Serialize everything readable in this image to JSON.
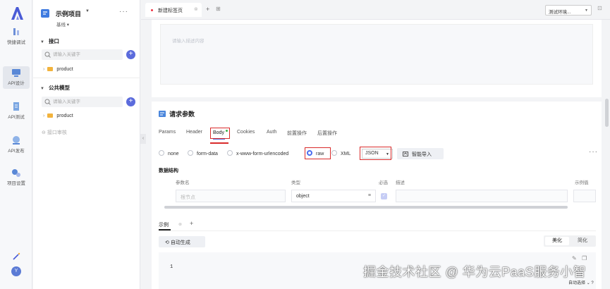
{
  "rail": {
    "items": [
      {
        "label": "快捷调试",
        "icon": "bug-debug-icon"
      },
      {
        "label": "API设计",
        "icon": "api-design-icon"
      },
      {
        "label": "API测试",
        "icon": "api-test-icon"
      },
      {
        "label": "API发布",
        "icon": "api-publish-icon"
      },
      {
        "label": "项目设置",
        "icon": "project-settings-icon"
      }
    ],
    "avatar_letter": "Y",
    "accent": "#5b6bdc"
  },
  "tree": {
    "project_name": "示例项目",
    "branch": "基线",
    "sections": [
      {
        "title": "接口",
        "search_placeholder": "请输入关键字",
        "node": "product"
      },
      {
        "title": "公共模型",
        "search_placeholder": "请输入关键字",
        "node": "product"
      }
    ],
    "recycle_label": "接口审核"
  },
  "tabbar": {
    "tab_label": "新建标签页",
    "env_label": "测试环境...",
    "env_caret": "▼"
  },
  "description": {
    "placeholder": "请输入描述内容"
  },
  "request": {
    "title": "请求参数",
    "tabs": [
      "Params",
      "Header",
      "Body",
      "Cookies",
      "Auth",
      "前置操作",
      "后置操作"
    ],
    "body_types": [
      "none",
      "form-data",
      "x-www-form-urlencoded",
      "raw",
      "XML"
    ],
    "selected_body_type": "raw",
    "format": "JSON",
    "smart_import_label": "智能导入",
    "data_structure_title": "数据结构",
    "columns": [
      "参数名",
      "类型",
      "必选",
      "描述",
      "示例值"
    ],
    "row": {
      "name_placeholder": "根节点",
      "type": "object",
      "required": true
    },
    "example_tab": "示例",
    "auto_generate_label": "自动生成",
    "beautify_label": "美化",
    "simplify_label": "简化",
    "line_number": "1"
  },
  "footer": {
    "auto_select": "自动选择"
  },
  "watermark": "掘金技术社区 @ 华为云PaaS服务小智",
  "colors": {
    "highlight_box": "#d92b2b",
    "radio_checked": "#4a6cf0",
    "body_dot": "#3bb34a"
  }
}
